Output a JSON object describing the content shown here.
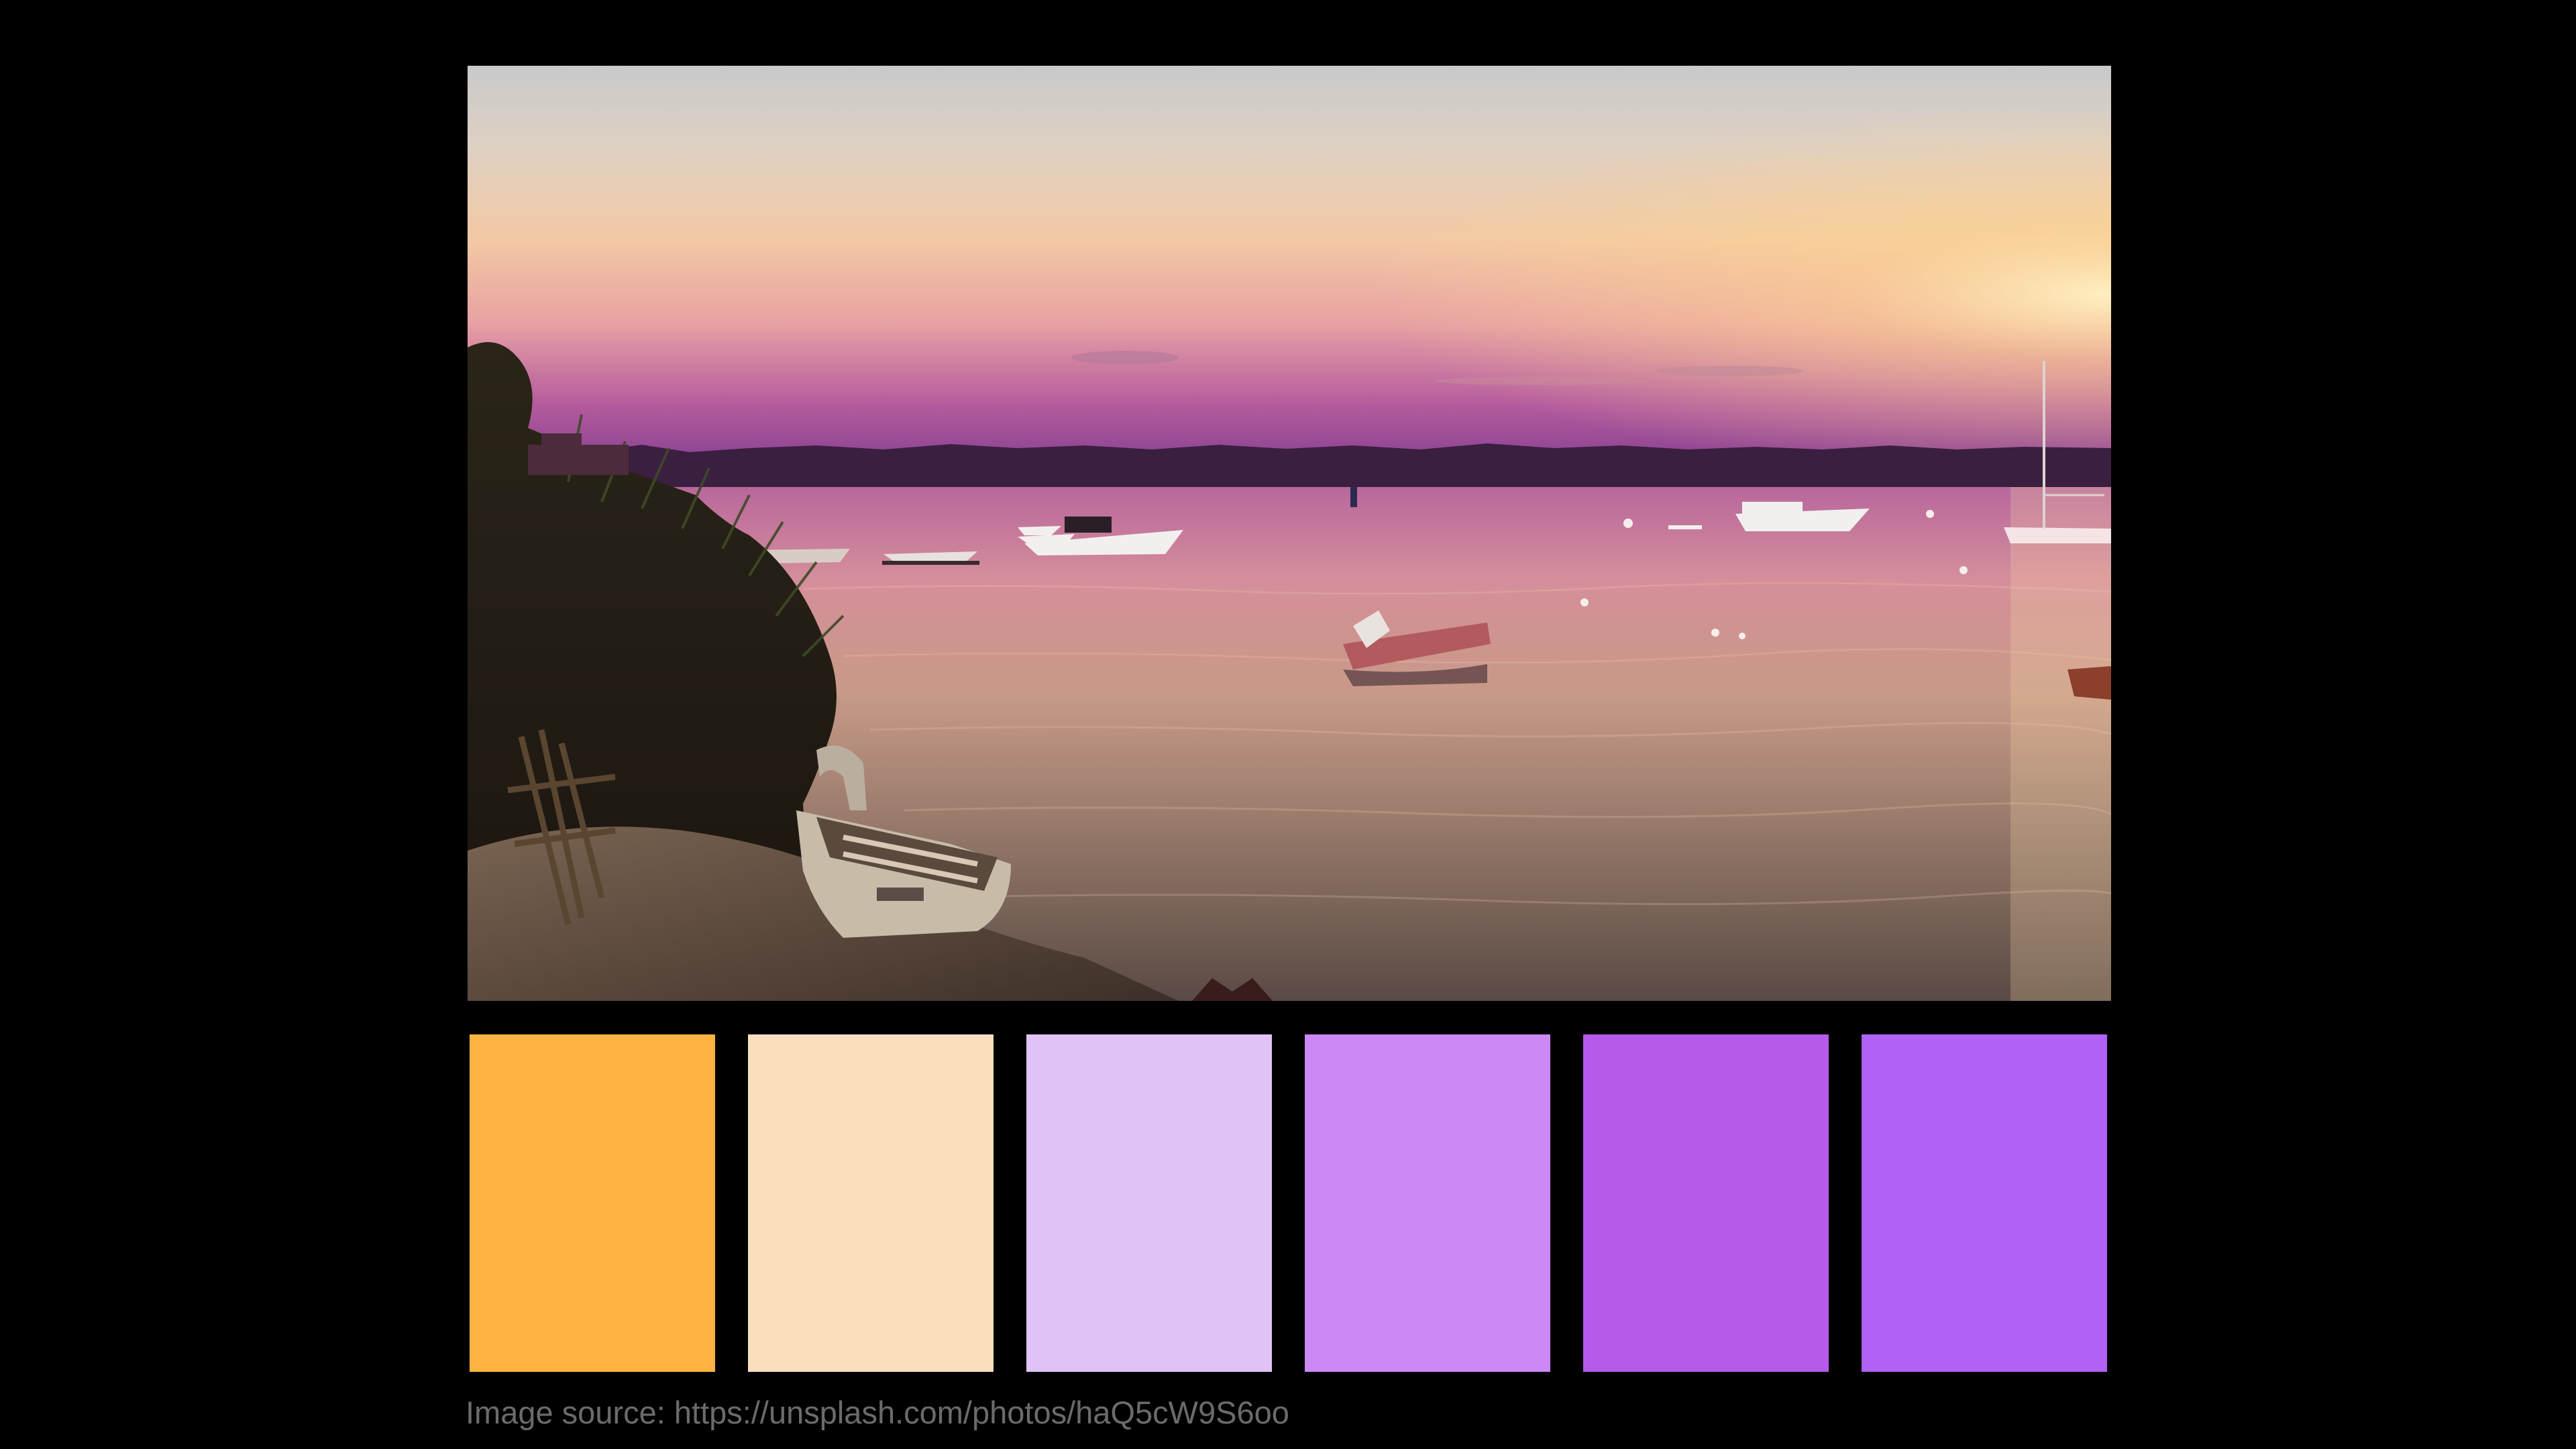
{
  "photo": {
    "subject": "sunset over a calm bay with moored boats"
  },
  "palette": [
    {
      "color": "#FDB242"
    },
    {
      "color": "#FADFBD"
    },
    {
      "color": "#E1C2F6"
    },
    {
      "color": "#CC88F5"
    },
    {
      "color": "#B65AEB"
    },
    {
      "color": "#B062F5"
    }
  ],
  "caption": {
    "text": "Image source: https://unsplash.com/photos/haQ5cW9S6oo"
  }
}
